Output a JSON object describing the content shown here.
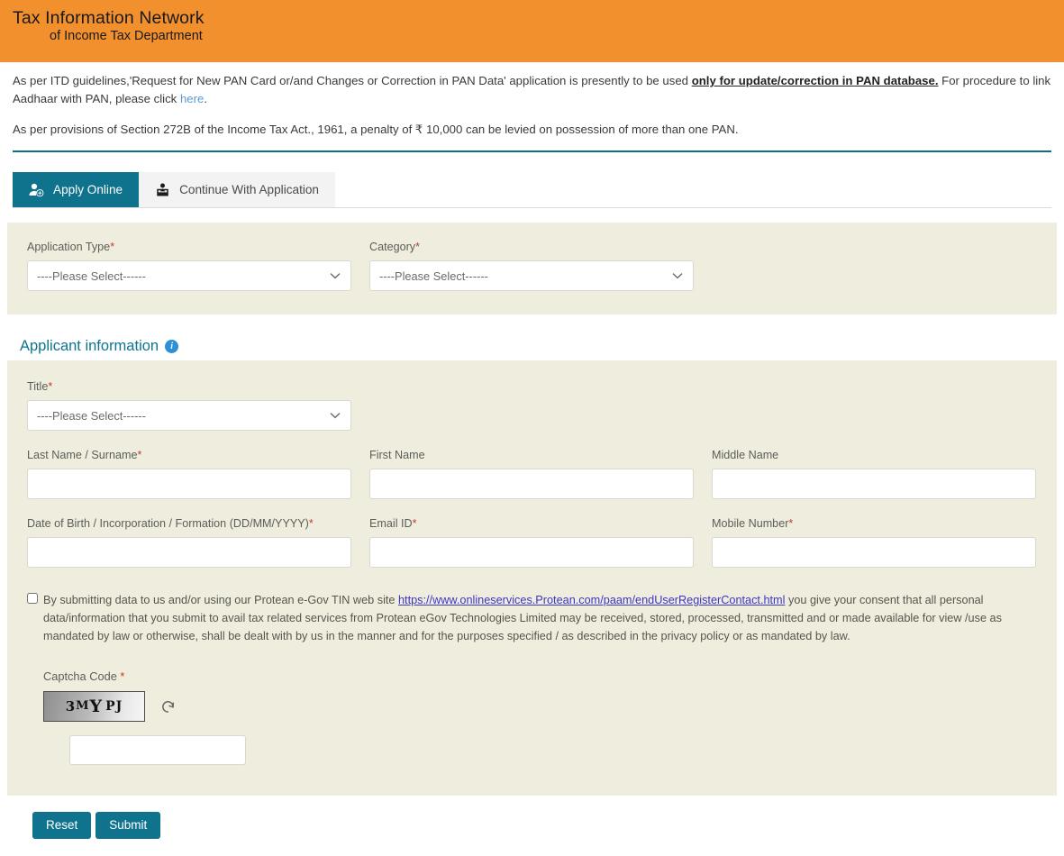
{
  "header": {
    "brand_line1": "Tax Information Network",
    "brand_line2": "of Income Tax Department",
    "bg_color": "#F2902E"
  },
  "notices": {
    "notice1_part1": "As per ITD guidelines,'Request for New PAN Card or/and Changes or Correction in PAN Data' application is presently to be used ",
    "notice1_strong": "only for update/correction in PAN database.",
    "notice1_part2": " For procedure to link Aadhaar with PAN, please click ",
    "notice1_link": "here",
    "notice1_part3": ".",
    "notice2": "As per provisions of Section 272B of the Income Tax Act., 1961, a penalty of ₹ 10,000 can be levied on possession of more than one PAN."
  },
  "tabs": [
    {
      "label": "Apply Online",
      "icon": "user-add-icon",
      "active": true
    },
    {
      "label": "Continue With Application",
      "icon": "user-continue-icon",
      "active": false
    }
  ],
  "form": {
    "application_type": {
      "label": "Application Type",
      "required": "*",
      "value": "----Please Select------"
    },
    "category": {
      "label": "Category",
      "required": "*",
      "value": "----Please Select------"
    },
    "section_title": "Applicant information",
    "title_field": {
      "label": "Title",
      "required": "*",
      "value": "----Please Select------"
    },
    "last_name": {
      "label": "Last Name / Surname",
      "required": "*",
      "value": "",
      "placeholder": ""
    },
    "first_name": {
      "label": "First Name",
      "required": "",
      "value": "",
      "placeholder": ""
    },
    "middle_name": {
      "label": "Middle Name",
      "required": "",
      "value": "",
      "placeholder": ""
    },
    "dob": {
      "label": "Date of Birth / Incorporation / Formation (DD/MM/YYYY)",
      "required": "*",
      "value": "",
      "placeholder": ""
    },
    "email": {
      "label": "Email ID",
      "required": "*",
      "value": "",
      "placeholder": ""
    },
    "mobile": {
      "label": "Mobile Number",
      "required": "*",
      "value": "",
      "placeholder": ""
    }
  },
  "consent": {
    "part1": "By submitting data to us and/or using our Protean e-Gov TIN web site ",
    "link": "https://www.onlineservices.Protean.com/paam/endUserRegisterContact.html",
    "part2": " you give your consent that all personal data/information that you submit to avail tax related services from Protean eGov Technologies Limited may be received, stored, processed, transmitted and or made available for view /use as mandated by law or otherwise, shall be dealt with by us in the manner and for the purposes specified / as described in the privacy policy or as mandated by law.",
    "checked": false
  },
  "captcha": {
    "label": "Captcha Code ",
    "required": "*",
    "code_chars": [
      "3",
      "M",
      "Y",
      "PJ"
    ],
    "code_text": "3MYPJ",
    "input_value": "",
    "refresh_icon": "refresh-icon"
  },
  "actions": {
    "reset_label": "Reset",
    "submit_label": "Submit"
  },
  "colors": {
    "accent_teal": "#10738E",
    "header_orange": "#F2902E",
    "panel_beige": "#EFEEDE",
    "link_blue": "#3d36c4",
    "required_red": "#c0392b"
  }
}
